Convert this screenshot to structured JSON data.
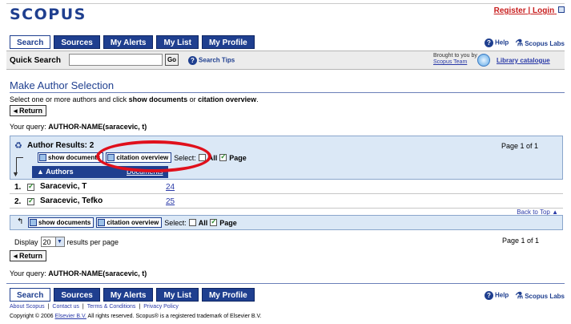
{
  "header": {
    "logo": "SCOPUS",
    "register_label": "Register",
    "login_label": "Login",
    "separator": "|"
  },
  "top_tabs": [
    "Search",
    "Sources",
    "My Alerts",
    "My List",
    "My Profile"
  ],
  "help_links": {
    "help": "Help",
    "labs": "Scopus Labs"
  },
  "quick_search": {
    "label": "Quick Search",
    "value": "",
    "go_label": "Go",
    "tips_label": "Search Tips",
    "brought_by": "Brought to you by",
    "brought_link": "Scopus Team",
    "library_link": "Library catalogue"
  },
  "main": {
    "title": "Make Author Selection",
    "instruction_prefix": "Select one or more authors and click ",
    "instruction_show": "show documents",
    "instruction_or": " or ",
    "instruction_cite": "citation overview",
    "instruction_end": ".",
    "return_label": "Return",
    "query_label": "Your query: ",
    "query_value": "AUTHOR-NAME(saracevic, t)"
  },
  "results": {
    "header_label": "Author Results: 2",
    "page_info": "Page 1 of 1",
    "show_documents_label": "show documents",
    "citation_overview_label": "citation overview",
    "select_label": "Select:",
    "all_label": "All",
    "page_label": "Page",
    "columns": {
      "authors": "Authors",
      "documents": "Documents"
    },
    "rows": [
      {
        "num": "1.",
        "name": "Saracevic, T",
        "count": "24"
      },
      {
        "num": "2.",
        "name": "Saracevic, Tefko",
        "count": "25"
      }
    ],
    "back_to_top": "Back to Top"
  },
  "display": {
    "prefix": "Display",
    "value": "20",
    "suffix": "results per page",
    "page_info": "Page 1 of 1"
  },
  "footer": {
    "links": [
      "About Scopus",
      "Contact us",
      "Terms & Conditions",
      "Privacy Policy"
    ],
    "copyright_prefix": "Copyright © 2006 ",
    "copyright_link": "Elsevier B.V.",
    "copyright_suffix": " All rights reserved. Scopus® is a registered trademark of Elsevier B.V."
  },
  "colors": {
    "brand": "#1f3f8f",
    "highlight_circle": "#e0101c",
    "results_bg": "#dbe8f6"
  }
}
